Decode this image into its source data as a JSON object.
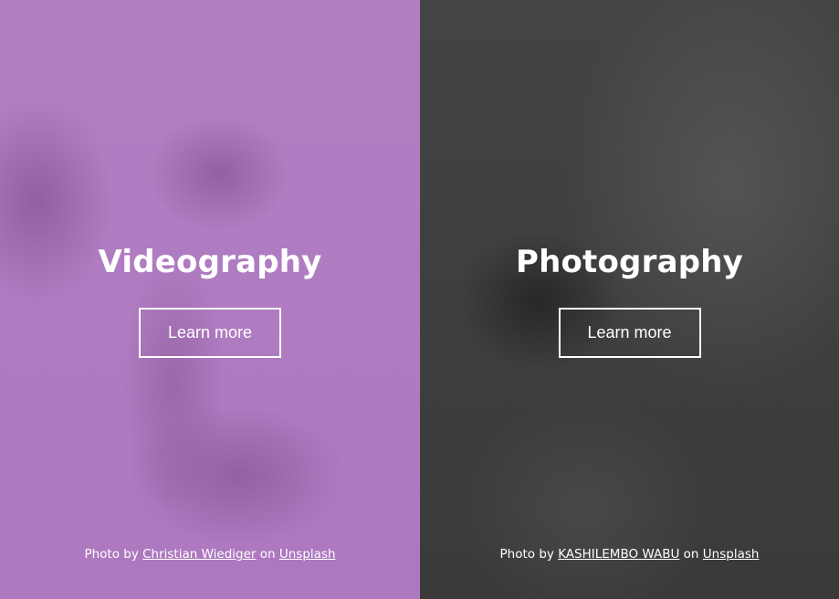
{
  "panels": [
    {
      "title": "Videography",
      "button_label": "Learn more",
      "credit": {
        "prefix": "Photo by",
        "author": "Christian Wiediger",
        "middle": "on",
        "source": "Unsplash"
      },
      "overlay_color": "#b07cc0"
    },
    {
      "title": "Photography",
      "button_label": "Learn more",
      "credit": {
        "prefix": "Photo by",
        "author": "KASHILEMBO WABU",
        "middle": "on",
        "source": "Unsplash"
      },
      "overlay_color": "#3d3d3d"
    }
  ]
}
